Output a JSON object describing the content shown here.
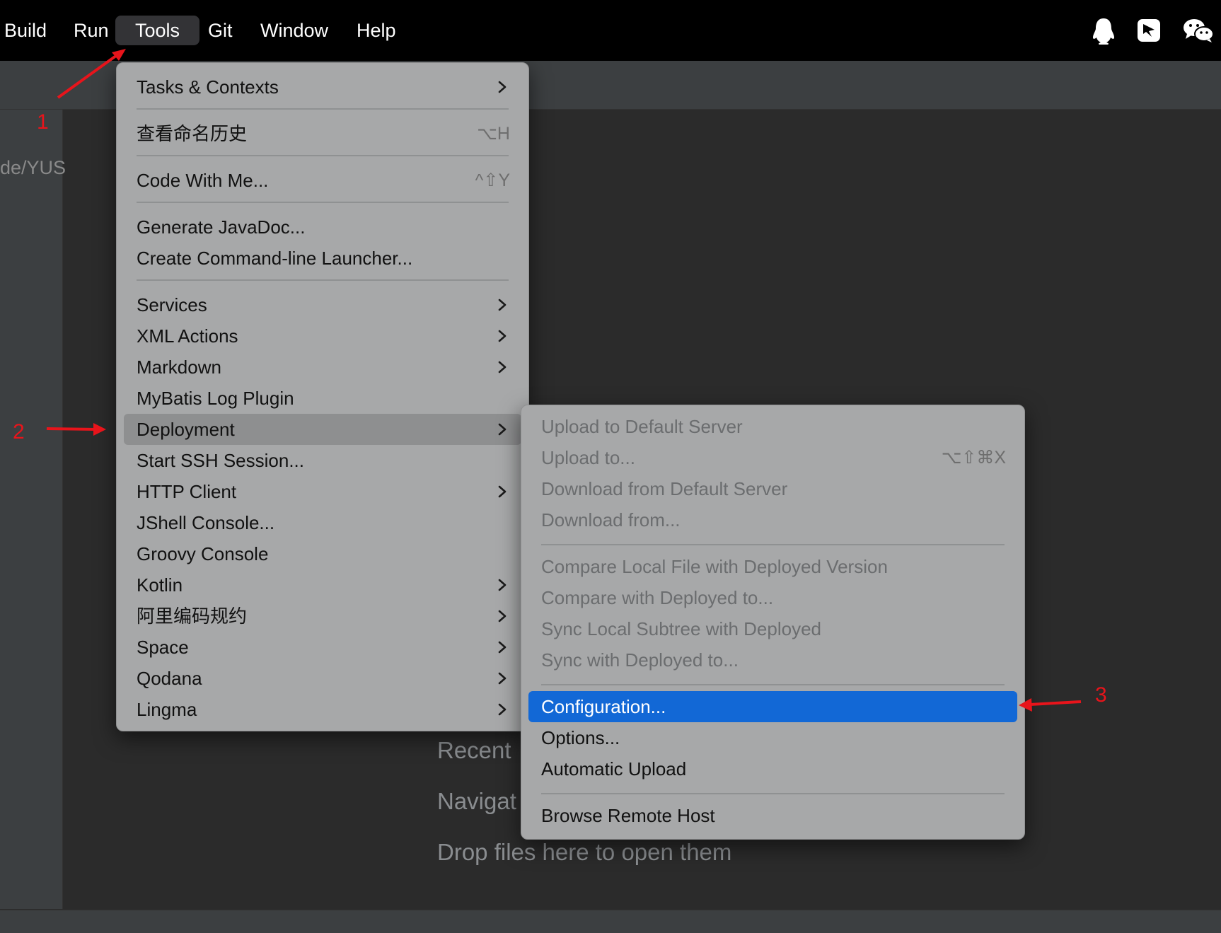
{
  "menubar": {
    "items": [
      "Build",
      "Run",
      "Tools",
      "Git",
      "Window",
      "Help"
    ],
    "active": "Tools",
    "tray_icons": [
      "qq-penguin-icon",
      "dingtalk-icon",
      "wechat-icon"
    ]
  },
  "editor": {
    "left_path": "de/YUS",
    "welcome_hints": [
      "Recent",
      "Navigat",
      "Drop files here to open them"
    ]
  },
  "tools_menu": {
    "items": [
      {
        "label": "Tasks & Contexts",
        "shortcut": "",
        "submenu": true
      },
      {
        "label": "查看命名历史",
        "shortcut": "⌥H",
        "submenu": false
      },
      {
        "label": "Code With Me...",
        "shortcut": "^⇧Y",
        "submenu": false
      },
      {
        "label": "Generate JavaDoc...",
        "shortcut": "",
        "submenu": false
      },
      {
        "label": "Create Command-line Launcher...",
        "shortcut": "",
        "submenu": false
      },
      {
        "label": "Services",
        "shortcut": "",
        "submenu": true
      },
      {
        "label": "XML Actions",
        "shortcut": "",
        "submenu": true
      },
      {
        "label": "Markdown",
        "shortcut": "",
        "submenu": true
      },
      {
        "label": "MyBatis Log Plugin",
        "shortcut": "",
        "submenu": false
      },
      {
        "label": "Deployment",
        "shortcut": "",
        "submenu": true,
        "highlighted": true
      },
      {
        "label": "Start SSH Session...",
        "shortcut": "",
        "submenu": false
      },
      {
        "label": "HTTP Client",
        "shortcut": "",
        "submenu": true
      },
      {
        "label": "JShell Console...",
        "shortcut": "",
        "submenu": false
      },
      {
        "label": "Groovy Console",
        "shortcut": "",
        "submenu": false
      },
      {
        "label": "Kotlin",
        "shortcut": "",
        "submenu": true
      },
      {
        "label": "阿里编码规约",
        "shortcut": "",
        "submenu": true
      },
      {
        "label": "Space",
        "shortcut": "",
        "submenu": true
      },
      {
        "label": "Qodana",
        "shortcut": "",
        "submenu": true
      },
      {
        "label": "Lingma",
        "shortcut": "",
        "submenu": true
      }
    ]
  },
  "deployment_menu": {
    "items": [
      {
        "label": "Upload to Default Server",
        "shortcut": "",
        "enabled": false
      },
      {
        "label": "Upload to...",
        "shortcut": "⌥⇧⌘X",
        "enabled": false
      },
      {
        "label": "Download from Default Server",
        "shortcut": "",
        "enabled": false
      },
      {
        "label": "Download from...",
        "shortcut": "",
        "enabled": false
      },
      {
        "label": "Compare Local File with Deployed Version",
        "shortcut": "",
        "enabled": false
      },
      {
        "label": "Compare with Deployed to...",
        "shortcut": "",
        "enabled": false
      },
      {
        "label": "Sync Local Subtree with Deployed",
        "shortcut": "",
        "enabled": false
      },
      {
        "label": "Sync with Deployed to...",
        "shortcut": "",
        "enabled": false
      },
      {
        "label": "Configuration...",
        "shortcut": "",
        "enabled": true,
        "selected": true
      },
      {
        "label": "Options...",
        "shortcut": "",
        "enabled": true
      },
      {
        "label": "Automatic Upload",
        "shortcut": "",
        "enabled": true
      },
      {
        "label": "Browse Remote Host",
        "shortcut": "",
        "enabled": true
      }
    ]
  },
  "annotations": [
    "1",
    "2",
    "3"
  ],
  "colors": {
    "menubar_bg": "#000000",
    "menu_bg": "#a7a8a9",
    "selection": "#1268d6",
    "annotation_red": "#e8141b"
  }
}
